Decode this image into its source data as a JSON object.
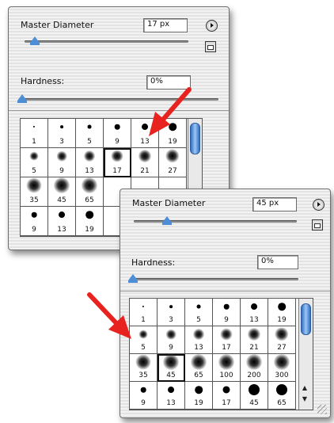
{
  "panel1": {
    "master_diameter_label": "Master Diameter",
    "diameter_value": "17 px",
    "diameter_slider_level": 0.2,
    "hardness_label": "Hardness:",
    "hardness_value": "0%",
    "hardness_slider_level": 0.0,
    "brushes": [
      {
        "size": "1"
      },
      {
        "size": "3"
      },
      {
        "size": "5"
      },
      {
        "size": "9"
      },
      {
        "size": "13"
      },
      {
        "size": "19"
      },
      {
        "size": "5"
      },
      {
        "size": "9"
      },
      {
        "size": "13"
      },
      {
        "size": "17",
        "selected": true
      },
      {
        "size": "21"
      },
      {
        "size": "27"
      },
      {
        "size": "35"
      },
      {
        "size": "45"
      },
      {
        "size": "65"
      },
      {
        "size": ""
      },
      {
        "size": ""
      },
      {
        "size": ""
      },
      {
        "size": "9"
      },
      {
        "size": "13"
      },
      {
        "size": "19"
      },
      {
        "size": ""
      },
      {
        "size": ""
      },
      {
        "size": ""
      }
    ]
  },
  "panel2": {
    "master_diameter_label": "Master Diameter",
    "diameter_value": "45 px",
    "diameter_slider_level": 0.2,
    "hardness_label": "Hardness:",
    "hardness_value": "0%",
    "hardness_slider_level": 0.0,
    "brushes": [
      {
        "size": "1"
      },
      {
        "size": "3"
      },
      {
        "size": "5"
      },
      {
        "size": "9"
      },
      {
        "size": "13"
      },
      {
        "size": "19"
      },
      {
        "size": "5"
      },
      {
        "size": "9"
      },
      {
        "size": "13"
      },
      {
        "size": "17"
      },
      {
        "size": "21"
      },
      {
        "size": "27"
      },
      {
        "size": "35"
      },
      {
        "size": "45",
        "selected": true
      },
      {
        "size": "65"
      },
      {
        "size": "100"
      },
      {
        "size": "200"
      },
      {
        "size": "300"
      },
      {
        "size": "9"
      },
      {
        "size": "13"
      },
      {
        "size": "19"
      },
      {
        "size": "17"
      },
      {
        "size": "45"
      },
      {
        "size": "65"
      }
    ]
  },
  "annotations": {
    "arrow_color": "#e8231f",
    "accent_color": "#4d8ed6"
  }
}
